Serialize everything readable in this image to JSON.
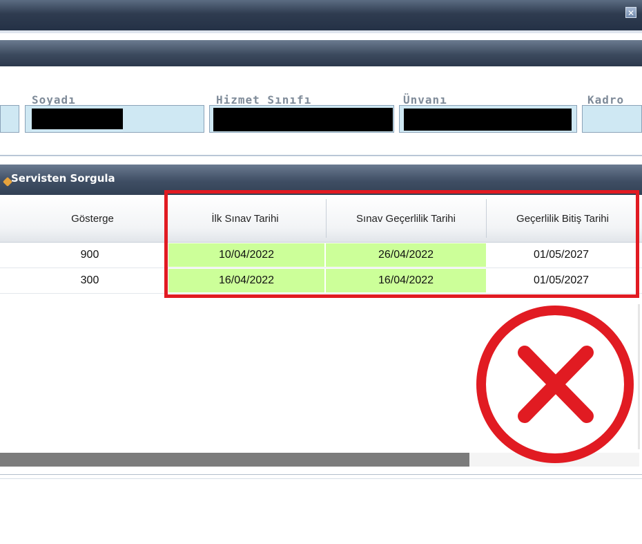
{
  "window": {
    "close_glyph": "✕"
  },
  "form": {
    "labels": {
      "soyadi": "Soyadı",
      "hizmet_sinifi": "Hizmet Sınıfı",
      "unvani": "Ünvanı",
      "kadro": "Kadro"
    }
  },
  "grid": {
    "title": "Servisten Sorgula",
    "columns": [
      "Gösterge",
      "İlk Sınav Tarihi",
      "Sınav Geçerlilik Tarihi",
      "Geçerlilik Bitiş Tarihi"
    ],
    "rows": [
      [
        "900",
        "10/04/2022",
        "26/04/2022",
        "01/05/2027"
      ],
      [
        "300",
        "16/04/2022",
        "16/04/2022",
        "01/05/2027"
      ]
    ]
  },
  "colors": {
    "highlight_cell": "#ccff99",
    "annotation_red": "#e11b22"
  },
  "icons": {
    "x_mark": "x-mark-icon",
    "close": "close-icon",
    "query": "pencil-icon"
  }
}
